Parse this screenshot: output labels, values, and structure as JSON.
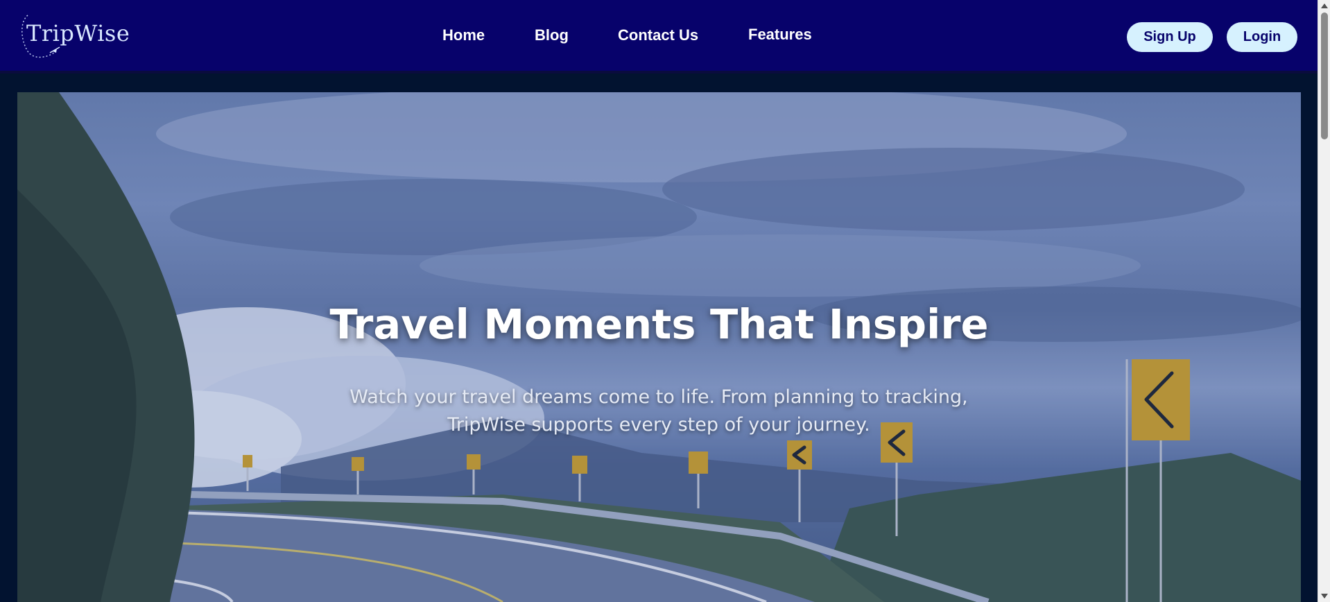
{
  "brand": {
    "name": "TripWise",
    "logo_icon": "plane-swoosh-icon"
  },
  "nav": {
    "links": [
      "Home",
      "Blog",
      "Contact Us",
      "Features"
    ]
  },
  "auth": {
    "signup_label": "Sign Up",
    "login_label": "Login"
  },
  "hero": {
    "title": "Travel Moments That Inspire",
    "subtitle": "Watch your travel dreams come to life. From planning to tracking, TripWise supports every step of your journey."
  },
  "colors": {
    "navbar_bg": "#07026b",
    "page_bg": "#021330",
    "button_bg": "#d6f1fe",
    "button_text": "#07026b"
  }
}
